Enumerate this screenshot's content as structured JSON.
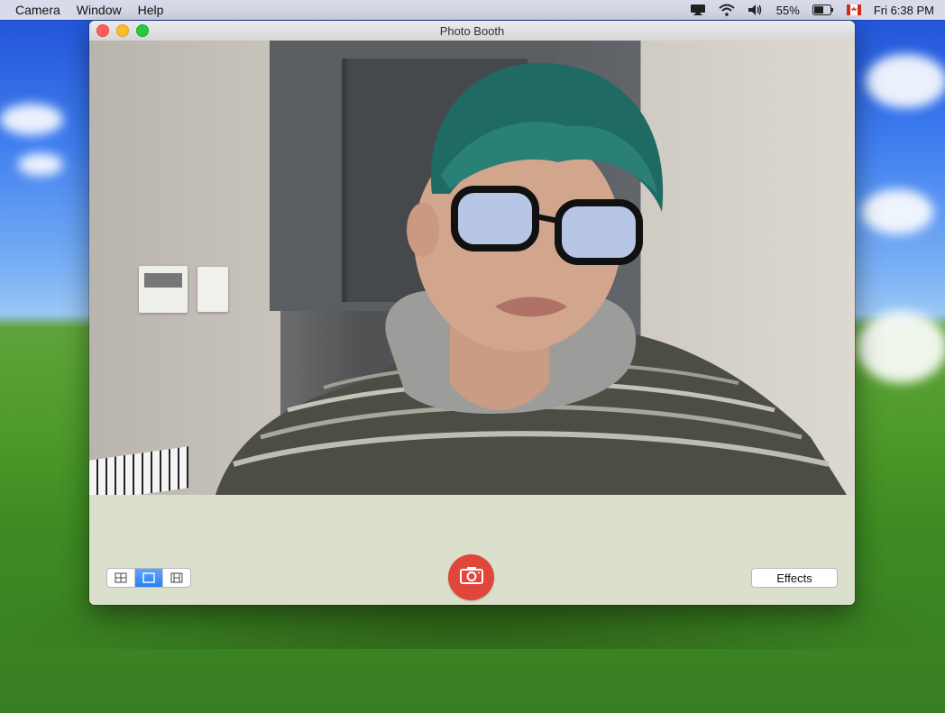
{
  "menubar": {
    "menus": [
      "Camera",
      "Window",
      "Help"
    ],
    "battery_percent": "55%",
    "clock": "Fri 6:38 PM",
    "icons": [
      "airplay-icon",
      "wifi-icon",
      "volume-icon",
      "battery-icon",
      "canada-flag-icon"
    ]
  },
  "window": {
    "title": "Photo Booth"
  },
  "controls": {
    "layout_modes": [
      "four-up-grid-icon",
      "single-photo-icon",
      "video-filmstrip-icon"
    ],
    "selected_mode": "single-photo-icon",
    "effects_label": "Effects",
    "shutter_color": "#e0463a"
  }
}
